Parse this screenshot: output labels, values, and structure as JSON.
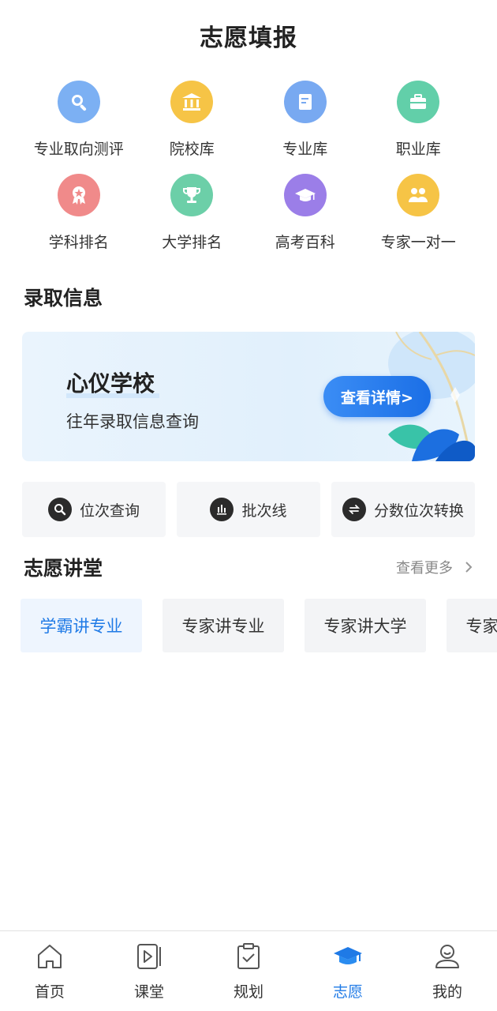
{
  "header": {
    "title": "志愿填报"
  },
  "grid": [
    {
      "label": "专业取向测评",
      "icon": "magnifier-icon",
      "color": "#7cb0f3"
    },
    {
      "label": "院校库",
      "icon": "institution-icon",
      "color": "#f6c446"
    },
    {
      "label": "专业库",
      "icon": "document-icon",
      "color": "#78a9f1"
    },
    {
      "label": "职业库",
      "icon": "briefcase-icon",
      "color": "#62cfa9"
    },
    {
      "label": "学科排名",
      "icon": "award-medal-icon",
      "color": "#f08a8a"
    },
    {
      "label": "大学排名",
      "icon": "trophy-icon",
      "color": "#6ccfa8"
    },
    {
      "label": "高考百科",
      "icon": "graduation-cap-icon",
      "color": "#9b7ee8"
    },
    {
      "label": "专家一对一",
      "icon": "people-icon",
      "color": "#f6c446"
    }
  ],
  "admission": {
    "section_title": "录取信息",
    "banner": {
      "title": "心仪学校",
      "subtitle": "往年录取信息查询",
      "button": "查看详情>"
    }
  },
  "tools": [
    {
      "label": "位次查询",
      "icon": "search-icon"
    },
    {
      "label": "批次线",
      "icon": "bar-chart-icon"
    },
    {
      "label": "分数位次转换",
      "icon": "swap-icon"
    }
  ],
  "lecture": {
    "section_title": "志愿讲堂",
    "more_label": "查看更多",
    "tags": [
      "学霸讲专业",
      "专家讲专业",
      "专家讲大学",
      "专家讲招生"
    ],
    "active_tag": 0
  },
  "tabbar": {
    "items": [
      {
        "label": "首页",
        "icon": "home-icon"
      },
      {
        "label": "课堂",
        "icon": "video-icon"
      },
      {
        "label": "规划",
        "icon": "clipboard-check-icon"
      },
      {
        "label": "志愿",
        "icon": "graduation-cap-icon"
      },
      {
        "label": "我的",
        "icon": "user-icon"
      }
    ],
    "active": 3,
    "active_color": "#1f7ae6"
  }
}
